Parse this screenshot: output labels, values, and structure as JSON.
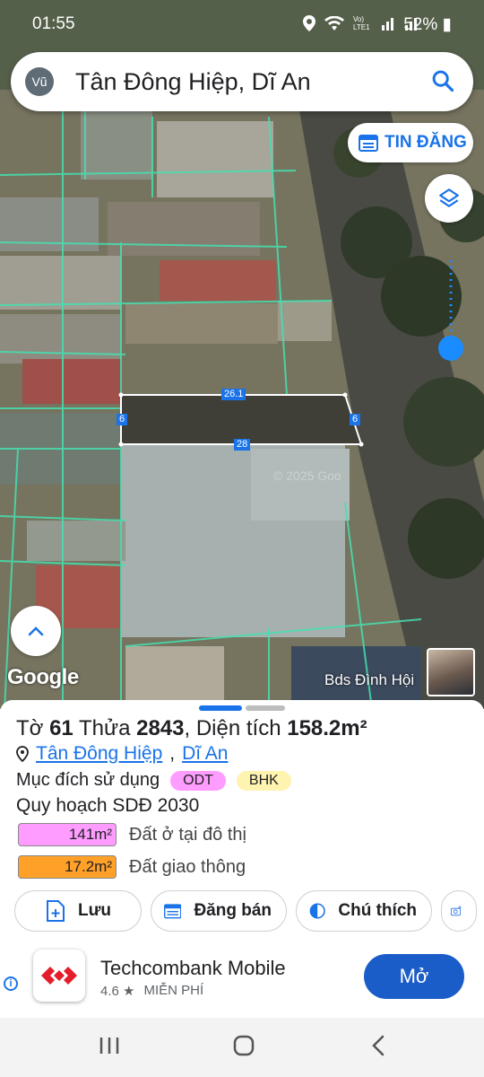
{
  "status": {
    "time": "01:55",
    "net_label": "Vo) LTE1",
    "battery": "52%"
  },
  "search": {
    "avatar_initials": "Vũ",
    "query": "Tân Đông Hiệp, Dĩ An"
  },
  "map": {
    "tin_dang_label": "TIN ĐĂNG",
    "google_label": "Google",
    "owner_label": "Bds Đình Hội",
    "watermark": "© 2025 Goo",
    "plot_dims": {
      "top": "26.1",
      "left": "6",
      "right": "6",
      "bottom": "28"
    }
  },
  "parcel": {
    "to_label": "Tờ",
    "to_value": "61",
    "thua_label": "Thửa",
    "thua_value": "2843",
    "area_label": ", Diện tích",
    "area_value": "158.2m²",
    "ward": "Tân Đông Hiệp",
    "sep": ",",
    "district": "Dĩ An",
    "purpose_label": "Mục đích sử dụng",
    "purpose_tags": [
      "ODT",
      "BHK"
    ],
    "plan_title": "Quy hoạch SDĐ 2030",
    "plan_rows": [
      {
        "area": "141m²",
        "label": "Đất ở tại đô thị",
        "color": "#ff9cff"
      },
      {
        "area": "17.2m²",
        "label": "Đất giao thông",
        "color": "#ffa028"
      }
    ]
  },
  "actions": {
    "save": "Lưu",
    "sell": "Đăng bán",
    "legend": "Chú thích"
  },
  "ad": {
    "app_name": "Techcombank Mobile",
    "rating": "4.6 ★",
    "price": "MIỄN PHÍ",
    "open": "Mở"
  }
}
